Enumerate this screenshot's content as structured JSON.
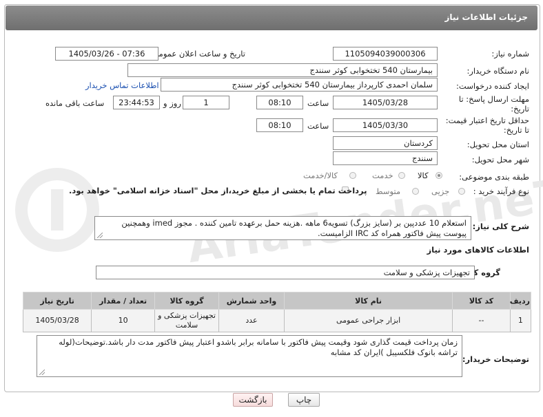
{
  "header": {
    "title": "جزئیات اطلاعات نیاز"
  },
  "watermark": {
    "text": "AriaTender.neT"
  },
  "fields": {
    "need_number_label": "شماره نیاز:",
    "need_number": "1105094039000306",
    "announce_label": "تاریخ و ساعت اعلان عمومی:",
    "announce_value": "1405/03/26 - 07:36",
    "buyer_org_label": "نام دستگاه خریدار:",
    "buyer_org": "بیمارستان 540 تختخوابی کوثر سنندج",
    "creator_label": "ایجاد کننده درخواست:",
    "creator": "سلمان احمدی کارپرداز بیمارستان 540 تختخوابی کوثر سنندج",
    "contact_link": "اطلاعات تماس خریدار",
    "deadline_label_1": "مهلت ارسال پاسخ: تا",
    "deadline_label_2": "تاریخ:",
    "deadline_date": "1405/03/28",
    "time_label": "ساعت",
    "deadline_time": "08:10",
    "day_count": "1",
    "day_label": "روز و",
    "remaining_time": "23:44:53",
    "remaining_label": "ساعت باقی مانده",
    "validity_label_1": "حداقل تاریخ اعتبار قیمت:",
    "validity_label_2": "تا تاریخ:",
    "validity_date": "1405/03/30",
    "validity_time": "08:10",
    "province_label": "استان محل تحویل:",
    "province": "کردستان",
    "city_label": "شهر محل تحویل:",
    "city": "سنندج",
    "category_label": "طبقه بندی موضوعی:",
    "category_options": [
      "کالا",
      "خدمت",
      "کالا/خدمت"
    ],
    "category_selected": "کالا",
    "process_label": "نوع فرآیند خرید :",
    "process_options": [
      "جزیی",
      "متوسط"
    ],
    "process_note": "پرداخت تمام یا بخشی از مبلغ خرید،از محل \"اسناد خزانه اسلامی\" خواهد بود."
  },
  "description": {
    "label": "شرح کلی نیاز:",
    "line1": "استعلام 10 عددپین بر (سایز بزرگ) تسویه6 ماهه .هزینه حمل برعهده تامین کننده . مجوز imed وهمچنین",
    "line2": "پیوست پیش فاکتور همراه کد IRC الزامیست."
  },
  "goods_section": {
    "title": "اطلاعات کالاهای مورد نیاز",
    "group_label": "گروه کالا:",
    "group_value": "تجهیزات پزشکی و سلامت"
  },
  "table": {
    "headers": [
      "ردیف",
      "کد کالا",
      "نام کالا",
      "واحد شمارش",
      "گروه کالا",
      "تعداد / مقدار",
      "تاریخ نیاز"
    ],
    "rows": [
      {
        "row": "1",
        "code": "--",
        "name": "ابزار جراحی عمومی",
        "unit": "عدد",
        "group_line1": "تجهیزات پزشکی و",
        "group_line2": "سلامت",
        "qty": "10",
        "date": "1405/03/28"
      }
    ]
  },
  "buyer_notes": {
    "label": "توضیحات خریدار:",
    "line1": "زمان پرداخت قیمت گذاری شود وقیمت پیش فاکتور با سامانه برابر باشدو اعتبار پیش فاکتور مدت دار باشد.توضیحات(لوله",
    "line2": "تراشه بانوک فلکسیبل )ایران کد مشابه"
  },
  "buttons": {
    "print": "چاپ",
    "back": "بازگشت"
  }
}
